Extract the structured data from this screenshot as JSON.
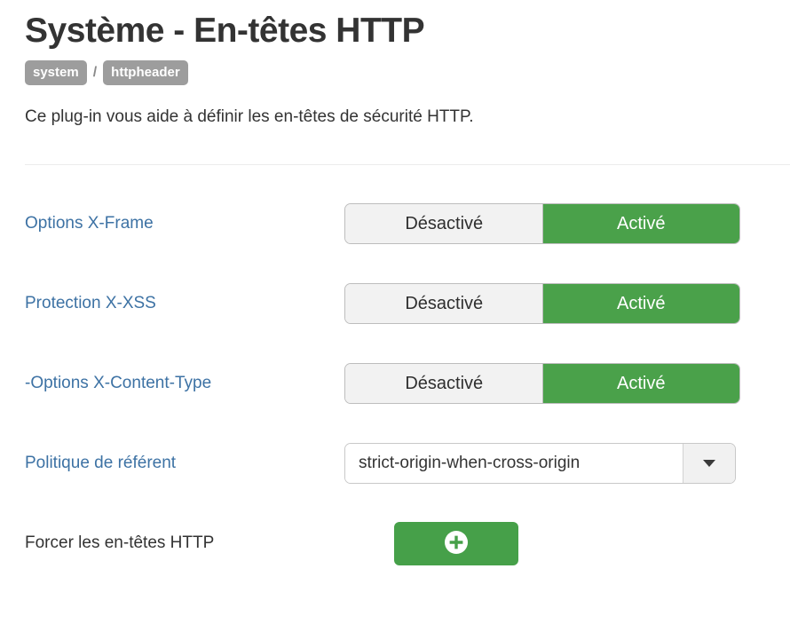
{
  "header": {
    "title": "Système - En-têtes HTTP",
    "breadcrumb": {
      "root": "system",
      "separator": "/",
      "leaf": "httpheader"
    },
    "description": "Ce plug-in vous aide à définir les en-têtes de sécurité HTTP."
  },
  "toggle_labels": {
    "off": "Désactivé",
    "on": "Activé"
  },
  "rows": [
    {
      "label": "Options X-Frame",
      "type": "toggle",
      "value": "on"
    },
    {
      "label": "Protection X-XSS",
      "type": "toggle",
      "value": "on"
    },
    {
      "label": "-Options X-Content-Type",
      "type": "toggle",
      "value": "on"
    },
    {
      "label": "Politique de référent",
      "type": "select",
      "value": "strict-origin-when-cross-origin"
    },
    {
      "label": "Forcer les en-têtes HTTP",
      "type": "button",
      "value": "add-icon"
    }
  ],
  "select": {
    "selected": "strict-origin-when-cross-origin"
  },
  "add_button": {
    "icon": "plus-circle-icon"
  },
  "colors": {
    "accent_green": "#4aa14a",
    "link_blue": "#3d72a4",
    "badge_gray": "#9d9d9d",
    "text_dark": "#333333",
    "control_gray": "#f2f2f2"
  }
}
